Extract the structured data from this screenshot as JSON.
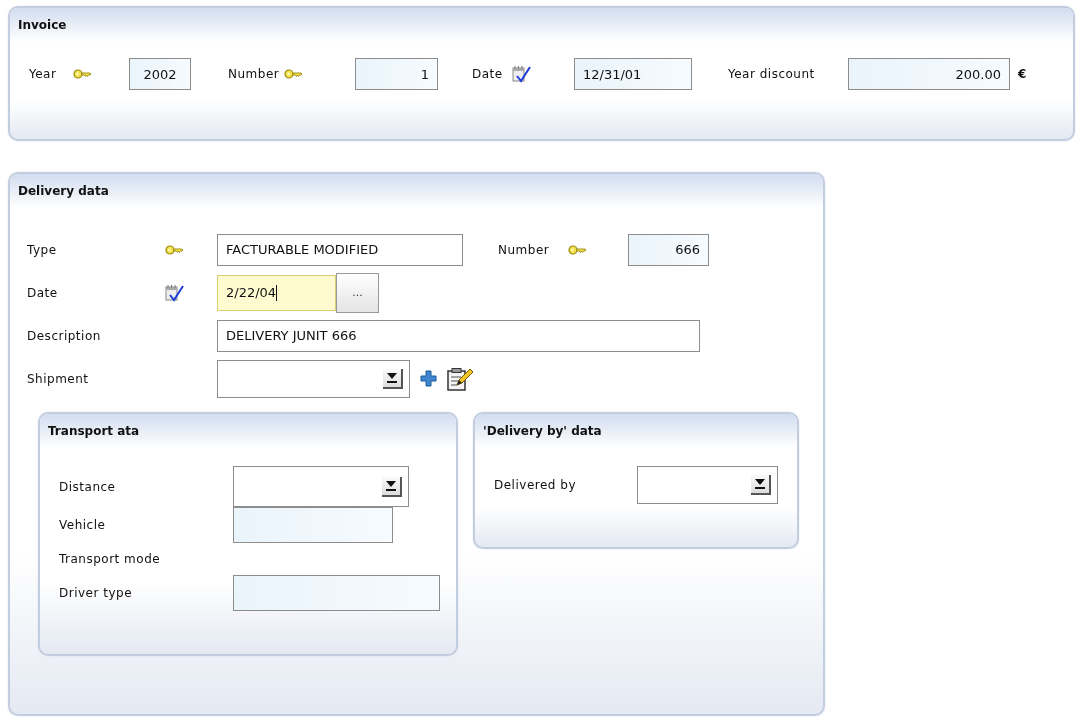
{
  "invoice": {
    "title": "Invoice",
    "fields": [
      {
        "label": "Year",
        "key": true,
        "kind": "number",
        "value": "2002",
        "editable": false
      },
      {
        "label": "Number",
        "key": true,
        "kind": "number",
        "value": "1",
        "editable": false
      },
      {
        "label": "Date",
        "kind": "date",
        "value": "12/31/01",
        "editable": false
      },
      {
        "label": "Year discount",
        "kind": "number",
        "value": "200.00",
        "editable": false,
        "unit": "€"
      }
    ]
  },
  "delivery": {
    "title": "Delivery data",
    "rows": [
      [
        {
          "label": "Type",
          "key": true,
          "kind": "text",
          "value": "FACTURABLE MODIFIED",
          "editable": true
        },
        {
          "label": "Number",
          "key": true,
          "kind": "number",
          "value": "666",
          "editable": false
        }
      ],
      [
        {
          "label": "Date",
          "kind": "date",
          "value": "2/22/04",
          "focused": true,
          "button": "..."
        }
      ],
      [
        {
          "label": "Description",
          "kind": "text",
          "value": "DELIVERY JUNIT 666",
          "editable": true
        }
      ],
      [
        {
          "label": "Shipment",
          "kind": "combo",
          "editable": true,
          "add_button": true,
          "edit_button": true
        }
      ]
    ],
    "panels": [
      {
        "title": "Transport ata",
        "fields": [
          {
            "label": "Distance",
            "kind": "combo",
            "editable": true
          },
          {
            "label": "Vehicle",
            "kind": "text",
            "editable": false
          },
          {
            "label": "Transport mode",
            "kind": "label"
          },
          {
            "label": "Driver type",
            "kind": "text",
            "editable": false
          }
        ]
      },
      {
        "title": "'Delivery by' data",
        "fields": [
          {
            "label": "Delivered by",
            "kind": "combo",
            "editable": true
          }
        ]
      }
    ]
  }
}
